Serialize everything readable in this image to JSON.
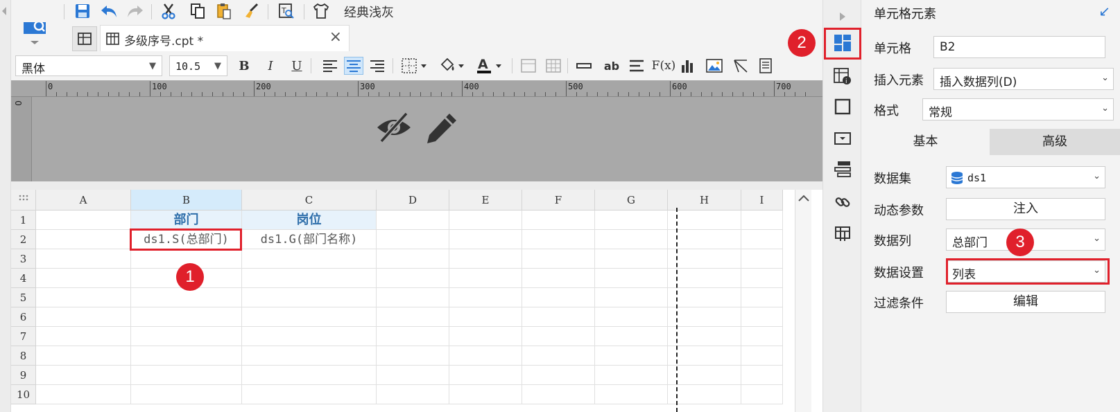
{
  "toolbar": {
    "theme_label": "经典浅灰"
  },
  "tab": {
    "file_name": "多级序号.cpt *",
    "close": "×"
  },
  "format": {
    "font_name": "黑体",
    "font_size": "10.5",
    "bold": "B",
    "italic": "I",
    "underline": "U",
    "insert_text": "ab",
    "formula": "F(x)"
  },
  "ruler": {
    "marks": [
      "0",
      "100",
      "200",
      "300",
      "400",
      "500",
      "600",
      "700"
    ],
    "vertical_zero": "0"
  },
  "grid": {
    "columns": [
      "A",
      "B",
      "C",
      "D",
      "E",
      "F",
      "G",
      "H",
      "I"
    ],
    "rows": [
      "1",
      "2",
      "3",
      "4",
      "5",
      "6",
      "7",
      "8",
      "9",
      "10"
    ],
    "header_row": {
      "B": "部门",
      "C": "岗位"
    },
    "data_row": {
      "B": "ds1.S(总部门)",
      "C": "ds1.G(部门名称)"
    }
  },
  "markers": [
    "1",
    "2",
    "3"
  ],
  "panel": {
    "title": "单元格元素",
    "cell_label": "单元格",
    "cell_value": "B2",
    "insert_label": "插入元素",
    "insert_value": "插入数据列(D)",
    "format_label": "格式",
    "format_value": "常规",
    "tab_basic": "基本",
    "tab_advanced": "高级",
    "dataset_label": "数据集",
    "dataset_value": "ds1",
    "dynamic_label": "动态参数",
    "dynamic_button": "注入",
    "column_label": "数据列",
    "column_value": "总部门",
    "setting_label": "数据设置",
    "setting_value": "列表",
    "filter_label": "过滤条件",
    "filter_button": "编辑"
  },
  "colors": {
    "accent": "#2b78d4",
    "highlight": "#e0202b",
    "header_text": "#2e6eaa"
  }
}
